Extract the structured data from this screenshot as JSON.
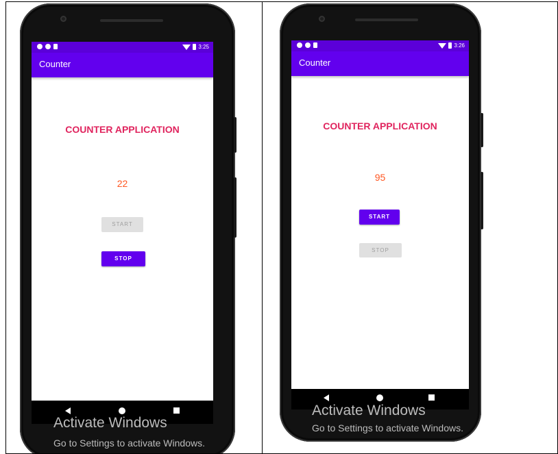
{
  "phones": [
    {
      "status": {
        "time": "3:25"
      },
      "app_title": "Counter",
      "heading": "COUNTER APPLICATION",
      "count": "22",
      "start_button": {
        "label": "START",
        "state": "disabled"
      },
      "stop_button": {
        "label": "STOP",
        "state": "enabled"
      }
    },
    {
      "status": {
        "time": "3:26"
      },
      "app_title": "Counter",
      "heading": "COUNTER APPLICATION",
      "count": "95",
      "start_button": {
        "label": "START",
        "state": "enabled"
      },
      "stop_button": {
        "label": "STOP",
        "state": "disabled"
      }
    }
  ],
  "watermark": {
    "title": "Activate Windows",
    "subtitle": "Go to Settings to activate Windows."
  },
  "colors": {
    "status_bar": "#5b00d9",
    "app_bar": "#6200ee",
    "heading": "#e0245e",
    "count": "#ff5722",
    "button_enabled": "#6200ee",
    "button_disabled": "#e0e0e0"
  }
}
